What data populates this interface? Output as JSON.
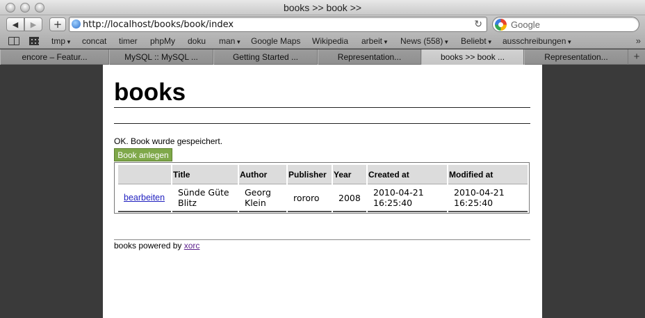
{
  "window": {
    "title": "books >> book >>"
  },
  "toolbar": {
    "back_icon": "back-arrow-icon",
    "forward_icon": "forward-arrow-icon",
    "add_icon": "plus-icon",
    "url": "http://localhost/books/book/index",
    "search_placeholder": "Google"
  },
  "bookmarks": [
    {
      "label": "tmp",
      "menu": true
    },
    {
      "label": "concat",
      "menu": false
    },
    {
      "label": "timer",
      "menu": false
    },
    {
      "label": "phpMy",
      "menu": false
    },
    {
      "label": "doku",
      "menu": false
    },
    {
      "label": "man",
      "menu": true
    },
    {
      "label": "Google Maps",
      "menu": false
    },
    {
      "label": "Wikipedia",
      "menu": false
    },
    {
      "label": "arbeit",
      "menu": true
    },
    {
      "label": "News (558)",
      "menu": true
    },
    {
      "label": "Beliebt",
      "menu": true
    },
    {
      "label": "ausschreibungen",
      "menu": true
    }
  ],
  "tabs": [
    {
      "label": "encore – Featur...",
      "active": false
    },
    {
      "label": "MySQL :: MySQL ...",
      "active": false
    },
    {
      "label": "Getting Started ...",
      "active": false
    },
    {
      "label": "Representation...",
      "active": false
    },
    {
      "label": "books >> book ...",
      "active": true
    },
    {
      "label": "Representation...",
      "active": false
    }
  ],
  "page": {
    "heading": "books",
    "flash": "OK. Book wurde gespeichert.",
    "add_button": "Book anlegen",
    "table": {
      "headers": [
        "",
        "Title",
        "Author",
        "Publisher",
        "Year",
        "Created at",
        "Modified at"
      ],
      "rows": [
        {
          "action": "bearbeiten",
          "title_line1": "Sünde Güte",
          "title_line2": "Blitz",
          "author_line1": "Georg",
          "author_line2": "Klein",
          "publisher": "rororo",
          "year": "2008",
          "created_line1": "2010-04-21",
          "created_line2": "16:25:40",
          "modified_line1": "2010-04-21",
          "modified_line2": "16:25:40"
        }
      ]
    },
    "footer_text": "books powered by ",
    "footer_link": "xorc"
  }
}
